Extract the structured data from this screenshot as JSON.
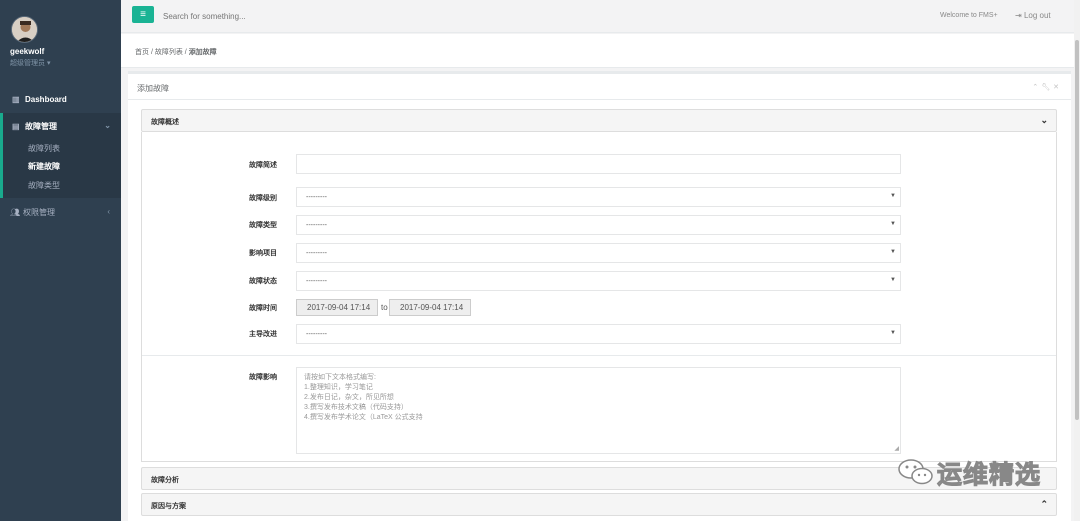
{
  "user": {
    "name": "geekwolf",
    "role": "超级管理员 ▾"
  },
  "nav": {
    "dashboard": "Dashboard",
    "fault_mgmt": "故障管理",
    "sub": [
      "故障列表",
      "新建故障",
      "故障类型"
    ],
    "perm_mgmt": "权限管理"
  },
  "topbar": {
    "search_placeholder": "Search for something...",
    "welcome": "Welcome to FMS+",
    "logout": "Log out"
  },
  "breadcrumb": {
    "home": "首页",
    "list": "故障列表",
    "current": "添加故障",
    "sep": " / "
  },
  "panel": {
    "title": "添加故障"
  },
  "sections": {
    "overview": "故障概述",
    "analysis": "故障分析",
    "cause": "原因与方案"
  },
  "form": {
    "summary_label": "故障简述",
    "level_label": "故障级别",
    "type_label": "故障类型",
    "project_label": "影响项目",
    "status_label": "故障状态",
    "time_label": "故障时间",
    "lead_label": "主导改进",
    "impact_label": "故障影响",
    "select_default": "---------",
    "time_start": "2017-09-04 17:14",
    "time_to": "to",
    "time_end": "2017-09-04 17:14",
    "impact_placeholder_lines": [
      "请按如下文本格式编写:",
      "1.整理知识，学习笔记",
      "2.发布日记，杂文，所见所想",
      "3.撰写发布技术文稿（代码支持）",
      "4.撰写发布学术论文（LaTeX 公式支持"
    ]
  },
  "watermark": "运维精选",
  "colors": {
    "sidebar": "#2f4050",
    "accent": "#1ab394"
  }
}
